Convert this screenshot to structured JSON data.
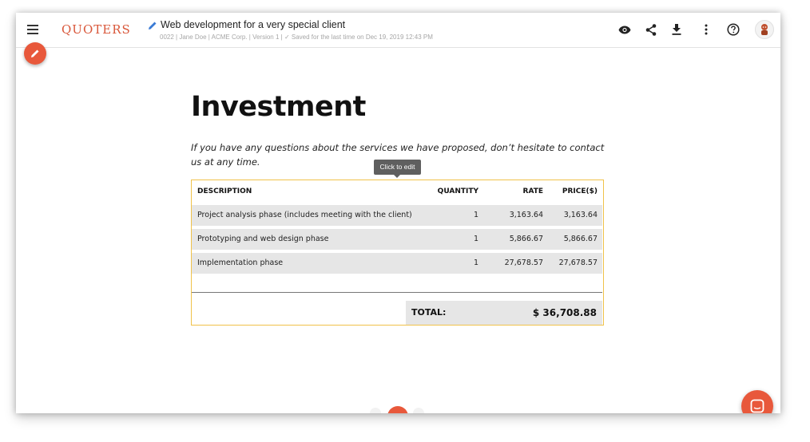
{
  "header": {
    "brand": "QUOTERS",
    "document_title": "Web development for a very special client",
    "document_meta": "0022 | Jane Doe | ACME Corp. | Version 1 | ✓ Saved for the last time on Dec 19, 2019 12:43 PM",
    "icons": [
      "menu-icon",
      "pencil-icon",
      "eye-icon",
      "share-icon",
      "download-icon",
      "more-vert-icon",
      "help-icon",
      "avatar"
    ]
  },
  "content": {
    "heading": "Investment",
    "intro": "If you have any questions about the services we have proposed, don’t hesitate to contact us at any time.",
    "tooltip": "Click to edit"
  },
  "table": {
    "columns": [
      "DESCRIPTION",
      "QUANTITY",
      "RATE",
      "PRICE($)"
    ],
    "rows": [
      [
        "Project analysis phase (includes meeting with the client)",
        "1",
        "3,163.64",
        "3,163.64"
      ],
      [
        "Prototyping and web design phase",
        "1",
        "5,866.67",
        "5,866.67"
      ],
      [
        "Implementation phase",
        "1",
        "27,678.57",
        "27,678.57"
      ]
    ],
    "total_label": "TOTAL:",
    "total_value": "$ 36,708.88"
  },
  "colors": {
    "accent": "#e8583b",
    "brand": "#d9573a",
    "table_border": "#f0c24a",
    "row_bg": "#e6e6e6"
  }
}
